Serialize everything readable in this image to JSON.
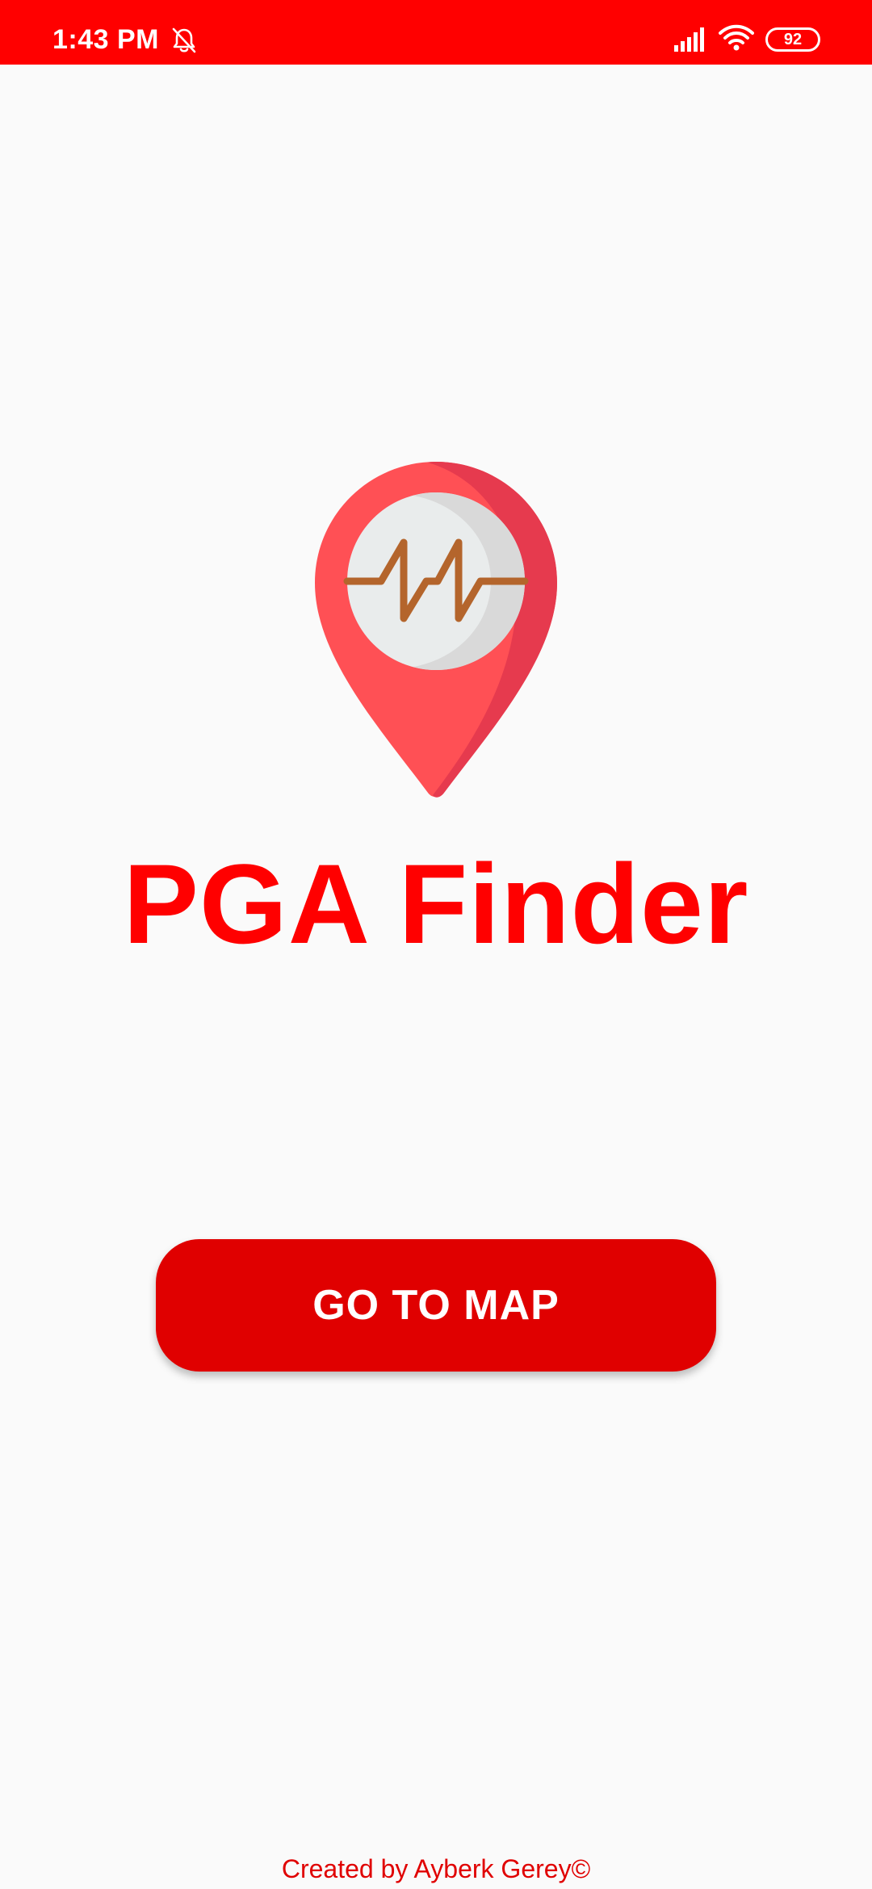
{
  "status_bar": {
    "time": "1:43 PM",
    "battery_level": "92",
    "background_color": "#ff0000",
    "icons": [
      "mute-icon",
      "signal-icon",
      "wifi-icon",
      "battery-icon"
    ]
  },
  "app": {
    "title": "PGA Finder",
    "logo_icon": "map-pin-seismograph-icon",
    "accent_color": "#ff0000"
  },
  "actions": {
    "go_to_map_label": "GO TO MAP",
    "button_color": "#e00000"
  },
  "footer": {
    "credit": "Created by Ayberk Gerey©"
  }
}
